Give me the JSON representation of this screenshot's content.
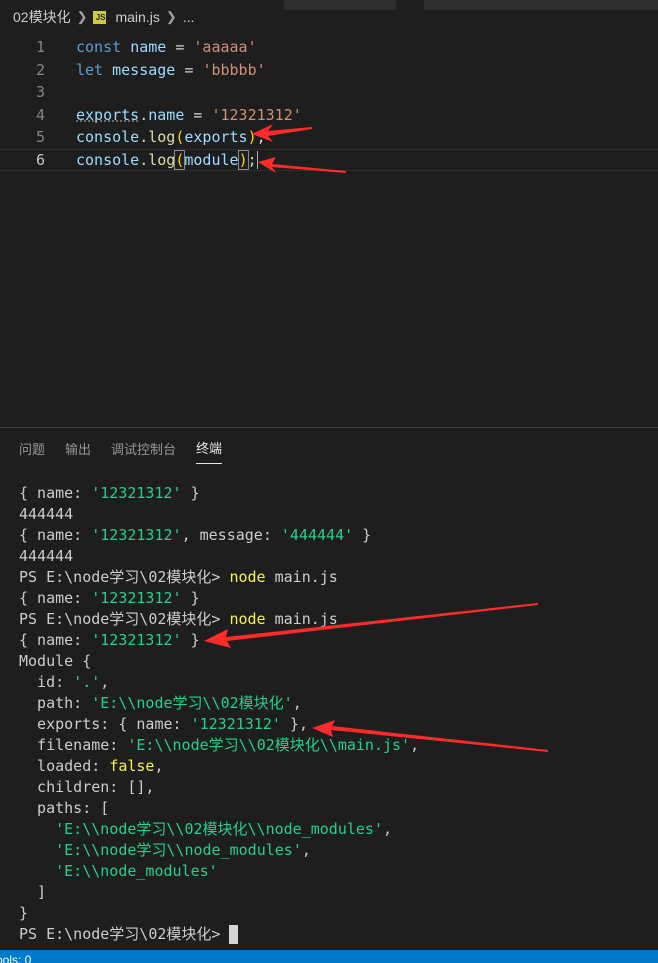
{
  "breadcrumb": {
    "folder": "02模块化",
    "file": "main.js",
    "tail": "..."
  },
  "editor": {
    "lines": [
      {
        "num": "1",
        "tokens": [
          [
            "kw",
            "const"
          ],
          [
            "plain",
            " "
          ],
          [
            "var",
            "name"
          ],
          [
            "plain",
            " = "
          ],
          [
            "str",
            "'aaaaa'"
          ]
        ]
      },
      {
        "num": "2",
        "tokens": [
          [
            "kw",
            "let"
          ],
          [
            "plain",
            " "
          ],
          [
            "var",
            "message"
          ],
          [
            "plain",
            " = "
          ],
          [
            "str",
            "'bbbbb'"
          ]
        ]
      },
      {
        "num": "3",
        "tokens": []
      },
      {
        "num": "4",
        "tokens": [
          [
            "obj",
            "exports"
          ],
          [
            "plain",
            "."
          ],
          [
            "var",
            "name"
          ],
          [
            "plain",
            " = "
          ],
          [
            "str",
            "'12321312'"
          ]
        ]
      },
      {
        "num": "5",
        "tokens": [
          [
            "obj",
            "console"
          ],
          [
            "plain",
            "."
          ],
          [
            "fn",
            "log"
          ],
          [
            "brk",
            "("
          ],
          [
            "obj",
            "exports"
          ],
          [
            "brk",
            ")"
          ],
          [
            "plain",
            ";"
          ]
        ]
      },
      {
        "num": "6",
        "tokens": [
          [
            "obj",
            "console"
          ],
          [
            "plain",
            "."
          ],
          [
            "fn",
            "log"
          ],
          [
            "brk",
            "("
          ],
          [
            "obj",
            "module"
          ],
          [
            "brk",
            ")"
          ],
          [
            "plain",
            ";"
          ]
        ]
      }
    ]
  },
  "panel": {
    "tabs": [
      "问题",
      "输出",
      "调试控制台",
      "终端"
    ],
    "active_tab": "终端"
  },
  "terminal": {
    "lines": [
      [
        [
          "p",
          "{ name: "
        ],
        [
          "s",
          "'12321312'"
        ],
        [
          "p",
          " }"
        ]
      ],
      [
        [
          "p",
          "444444"
        ]
      ],
      [
        [
          "p",
          "{ name: "
        ],
        [
          "s",
          "'12321312'"
        ],
        [
          "p",
          ", message: "
        ],
        [
          "s",
          "'444444'"
        ],
        [
          "p",
          " }"
        ]
      ],
      [
        [
          "p",
          "444444"
        ]
      ],
      [
        [
          "p",
          "PS E:\\node学习\\02模块化> "
        ],
        [
          "y",
          "node"
        ],
        [
          "p",
          " main.js"
        ]
      ],
      [
        [
          "p",
          "{ name: "
        ],
        [
          "s",
          "'12321312'"
        ],
        [
          "p",
          " }"
        ]
      ],
      [
        [
          "p",
          "PS E:\\node学习\\02模块化> "
        ],
        [
          "y",
          "node"
        ],
        [
          "p",
          " main.js"
        ]
      ],
      [
        [
          "p",
          "{ name: "
        ],
        [
          "s",
          "'12321312'"
        ],
        [
          "p",
          " }"
        ]
      ],
      [
        [
          "p",
          "Module {"
        ]
      ],
      [
        [
          "p",
          "  id: "
        ],
        [
          "s",
          "'.'"
        ],
        [
          "p",
          ","
        ]
      ],
      [
        [
          "p",
          "  path: "
        ],
        [
          "s",
          "'E:\\\\node学习\\\\02模块化'"
        ],
        [
          "p",
          ","
        ]
      ],
      [
        [
          "p",
          "  exports: { name: "
        ],
        [
          "s",
          "'12321312'"
        ],
        [
          "p",
          " },"
        ]
      ],
      [
        [
          "p",
          "  filename: "
        ],
        [
          "s",
          "'E:\\\\node学习\\\\02模块化\\\\main.js'"
        ],
        [
          "p",
          ","
        ]
      ],
      [
        [
          "p",
          "  loaded: "
        ],
        [
          "y",
          "false"
        ],
        [
          "p",
          ","
        ]
      ],
      [
        [
          "p",
          "  children: [],"
        ]
      ],
      [
        [
          "p",
          "  paths: ["
        ]
      ],
      [
        [
          "p",
          "    "
        ],
        [
          "s",
          "'E:\\\\node学习\\\\02模块化\\\\node_modules'"
        ],
        [
          "p",
          ","
        ]
      ],
      [
        [
          "p",
          "    "
        ],
        [
          "s",
          "'E:\\\\node学习\\\\node_modules'"
        ],
        [
          "p",
          ","
        ]
      ],
      [
        [
          "p",
          "    "
        ],
        [
          "s",
          "'E:\\\\node_modules'"
        ]
      ],
      [
        [
          "p",
          "  ]"
        ]
      ],
      [
        [
          "p",
          "}"
        ]
      ],
      [
        [
          "p",
          "PS E:\\node学习\\02模块化> "
        ],
        [
          "cursor",
          ""
        ]
      ]
    ]
  },
  "statusbar": {
    "text": "ools: 0"
  },
  "colors": {
    "keyword": "#569cd6",
    "variable": "#9cdcfe",
    "string": "#ce9178",
    "function": "#dcdcaa",
    "terminal_string": "#23d18b",
    "terminal_yellow": "#f5f543",
    "annotation_arrow": "#ff2a2a",
    "statusbar": "#007acc"
  }
}
